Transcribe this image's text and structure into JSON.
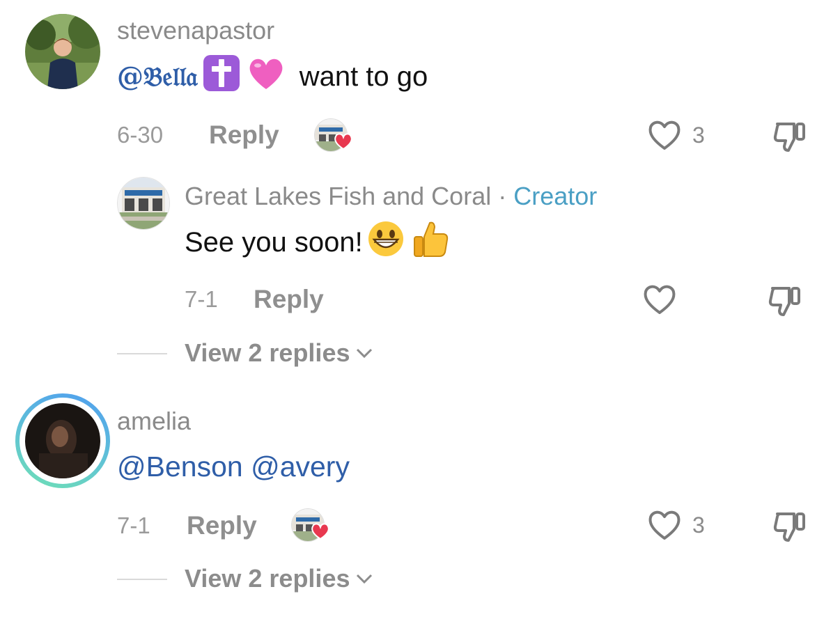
{
  "comments": [
    {
      "username": "stevenapastor",
      "mention": "@𝔅𝔢𝔩𝔩𝔞",
      "text": "want to go",
      "date": "6-30",
      "reply_label": "Reply",
      "like_count": "3",
      "creator_liked": true
    },
    {
      "username": "Great Lakes Fish and Coral",
      "separator": " · ",
      "badge": "Creator",
      "text": "See you soon!",
      "date": "7-1",
      "reply_label": "Reply",
      "like_count": "",
      "view_replies": "View 2 replies"
    },
    {
      "username": "amelia",
      "mention": "@Benson @avery",
      "date": "7-1",
      "reply_label": "Reply",
      "like_count": "3",
      "creator_liked": true,
      "view_replies": "View 2 replies"
    }
  ],
  "colors": {
    "mention": "#2f5ea8",
    "creator_badge": "#4a9fc4",
    "heart_badge": "#e8384f",
    "story_ring_start": "#4f9df0",
    "story_ring_end": "#6fe0b4"
  },
  "icons": [
    "heart-outline-icon",
    "dislike-icon",
    "chevron-down-icon",
    "heart-badge-icon",
    "cross-emoji",
    "pink-heart-emoji",
    "grinning-emoji",
    "thumbs-up-emoji"
  ]
}
